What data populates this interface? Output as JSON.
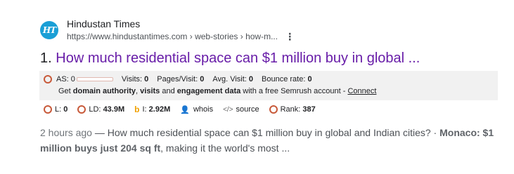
{
  "site": {
    "favicon_text": "HT",
    "name": "Hindustan Times",
    "url": "https://www.hindustantimes.com › web-stories › how-m..."
  },
  "result": {
    "number": "1.",
    "title": "How much residential space can $1 million buy in global ..."
  },
  "semrush": {
    "as_label": "AS:",
    "as_value": "0",
    "visits_label": "Visits:",
    "visits_value": "0",
    "pages_label": "Pages/Visit:",
    "pages_value": "0",
    "avg_label": "Avg. Visit:",
    "avg_value": "0",
    "bounce_label": "Bounce rate:",
    "bounce_value": "0",
    "promo_1": "Get ",
    "promo_b1": "domain authority",
    "promo_2": ", ",
    "promo_b2": "visits",
    "promo_3": " and ",
    "promo_b3": "engagement data",
    "promo_4": " with a free Semrush account - ",
    "promo_link": "Connect"
  },
  "stats": {
    "l_label": "L:",
    "l_value": "0",
    "ld_label": "LD:",
    "ld_value": "43.9M",
    "i_label": "I:",
    "i_value": "2.92M",
    "whois": "whois",
    "source": "source",
    "rank_label": "Rank:",
    "rank_value": "387"
  },
  "snippet": {
    "date": "2 hours ago",
    "text_1": " — How much residential space can $1 million buy in global and Indian cities? · ",
    "bold": "Monaco: $1 million buys just 204 sq ft",
    "text_2": ", making it the world's most ..."
  },
  "colors": {
    "link_visited": "#681da8",
    "favicon_bg": "#1a9fd6",
    "semrush_icon": "#c85a3a",
    "box_bg": "#f1f1f1"
  },
  "icons": [
    "ht-favicon-icon",
    "more-vert-icon",
    "semrush-circle-icon",
    "bing-icon",
    "person-icon",
    "code-icon"
  ]
}
